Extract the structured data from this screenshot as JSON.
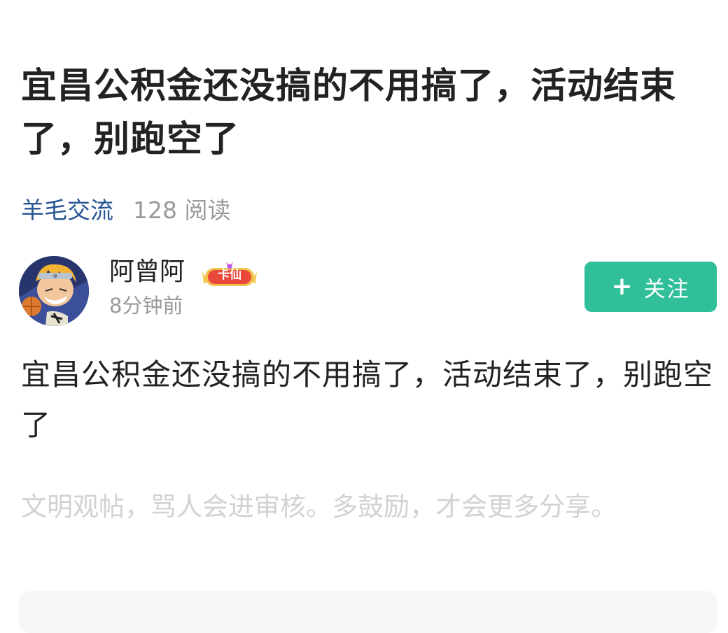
{
  "post": {
    "title": "宜昌公积金还没搞的不用搞了，活动结束了，别跑空了",
    "category": "羊毛交流",
    "views": "128 阅读",
    "content": "宜昌公积金还没搞的不用搞了，活动结束了，别跑空了"
  },
  "author": {
    "name": "阿曾阿",
    "badge": "卡仙",
    "time": "8分钟前"
  },
  "follow_button": {
    "label": "关注"
  },
  "comment_hint": "文明观帖，骂人会进审核。多鼓励，才会更多分享。",
  "colors": {
    "category": "#255592",
    "follow_bg": "#31bf9a",
    "title_text": "#222222",
    "muted_text": "#9a9a9a"
  }
}
